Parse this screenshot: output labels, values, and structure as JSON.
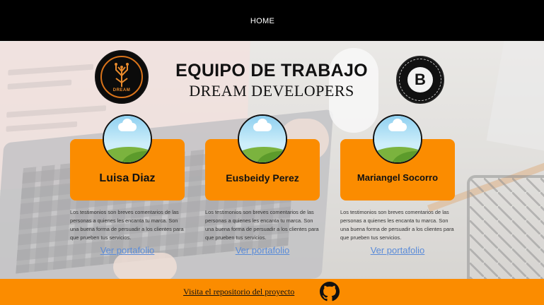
{
  "nav": {
    "home_label": "HOME"
  },
  "header": {
    "title": "EQUIPO DE TRABAJO",
    "subtitle": "DREAM DEVELOPERS",
    "logo_left_text": "DREAM",
    "logo_right_letter": "B"
  },
  "cards": [
    {
      "name": "Luisa Diaz",
      "description": "Los testimonios son breves comentarios de las personas a quienes les encanta tu marca. Son una buena forma de persuadir a los clientes para que prueben tus servicios.",
      "link_label": "Ver portafolio"
    },
    {
      "name": "Eusbeidy Perez",
      "description": "Los testimonios son breves comentarios de las personas a quienes les encanta tu marca. Son una buena forma de persuadir a los clientes para que prueben tus servicios.",
      "link_label": "Ver portafolio"
    },
    {
      "name": "Mariangel Socorro",
      "description": "Los testimonios son breves comentarios de las personas a quienes les encanta tu marca. Son una buena forma de persuadir a los clientes para que prueben tus servicios.",
      "link_label": "Ver portafolio"
    }
  ],
  "footer": {
    "repo_link": "Visita el repositorio del proyecto",
    "icon": "github-icon"
  },
  "colors": {
    "accent": "#fb8c00",
    "topbar": "#000000",
    "link": "#5a8bd8"
  }
}
